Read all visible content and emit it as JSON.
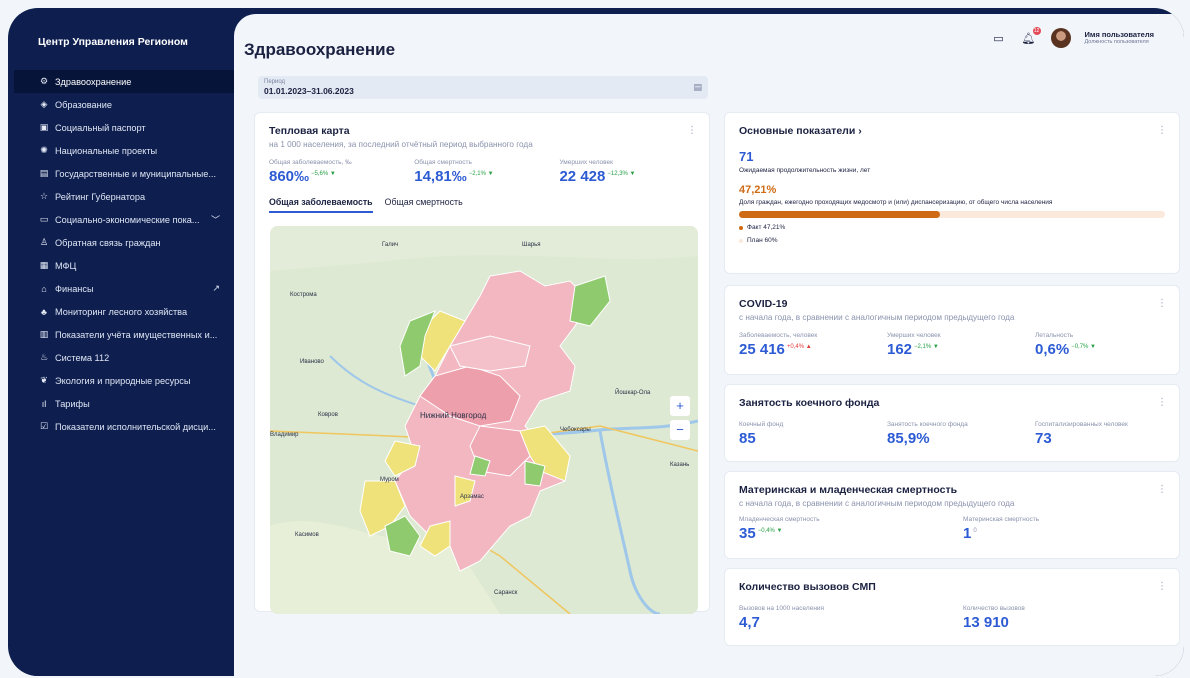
{
  "app": {
    "title": "Центр Управления Регионом"
  },
  "sidebar": {
    "items": [
      {
        "label": "Здравоохранение",
        "icon": "gear-icon",
        "active": true
      },
      {
        "label": "Образование",
        "icon": "graduation-cap-icon"
      },
      {
        "label": "Социальный паспорт",
        "icon": "id-card-icon"
      },
      {
        "label": "Национальные проекты",
        "icon": "emblem-icon"
      },
      {
        "label": "Государственные и муниципальные...",
        "icon": "document-icon"
      },
      {
        "label": "Рейтинг Губернатора",
        "icon": "star-icon"
      },
      {
        "label": "Социально-экономические пока...",
        "icon": "chat-icon",
        "trail": "chevron-down-icon"
      },
      {
        "label": "Обратная связь граждан",
        "icon": "people-icon"
      },
      {
        "label": "МФЦ",
        "icon": "mfc-icon"
      },
      {
        "label": "Финансы",
        "icon": "bank-icon",
        "trail": "external-link-icon"
      },
      {
        "label": "Мониторинг лесного хозяйства",
        "icon": "tree-icon"
      },
      {
        "label": "Показатели учёта имущественных и...",
        "icon": "building-icon"
      },
      {
        "label": "Система 112",
        "icon": "alarm-icon"
      },
      {
        "label": "Экология и природные ресурсы",
        "icon": "leaf-icon"
      },
      {
        "label": "Тарифы",
        "icon": "bars-icon"
      },
      {
        "label": "Показатели исполнительской дисци...",
        "icon": "check-doc-icon"
      }
    ]
  },
  "header": {
    "title": "Здравоохранение",
    "notifications_count": "12",
    "user_name": "Имя пользователя",
    "user_role": "Должность пользователя"
  },
  "period": {
    "label": "Период",
    "value": "01.01.2023–31.06.2023"
  },
  "heatmap": {
    "title": "Тепловая карта",
    "subtitle": "на 1 000 населения, за последний отчётный период выбранного года",
    "metrics": [
      {
        "label": "Общая заболеваемость, ‰",
        "value": "860‰",
        "delta": "−5,6% ▼",
        "trend": "down"
      },
      {
        "label": "Общая смертность",
        "value": "14,81‰",
        "delta": "−2,1% ▼",
        "trend": "down"
      },
      {
        "label": "Умерших человек",
        "value": "22 428",
        "delta": "−12,3% ▼",
        "trend": "down"
      }
    ],
    "tabs": [
      "Общая заболеваемость",
      "Общая смертность"
    ],
    "zoom_in": "+",
    "zoom_out": "−",
    "map_labels": {
      "nizhny": "Нижний Новгород",
      "kostroma": "Кострома",
      "ivanovo": "Иваново",
      "vladimir": "Владимир",
      "cheboksary": "Чебоксары",
      "arzamas": "Арзамас",
      "saransk": "Саранск",
      "kazan": "Казань",
      "murom": "Муром",
      "sharya": "Шарья",
      "galich": "Галич",
      "kovrov": "Ковров",
      "yoshkar": "Йошкар-Ола",
      "kasimov": "Касимов"
    },
    "colors": {
      "high": "#f2b7c1",
      "mid": "#f0e27a",
      "low": "#8fcb6e"
    }
  },
  "key_indicators": {
    "title": "Основные показатели ›",
    "life_value": "71",
    "life_label": "Ожидаемая продолжительность жизни, лет",
    "med_value": "47,21%",
    "med_label": "Доля граждан, ежегодно проходящих медосмотр и (или) диспансеризацию, от общего числа населения",
    "progress": 47.21,
    "fact": "Факт 47,21%",
    "plan": "План 60%"
  },
  "covid": {
    "title": "COVID-19",
    "subtitle": "с начала года, в сравнении с аналогичным периодом предыдущего года",
    "metrics": [
      {
        "label": "Заболеваемость, человек",
        "value": "25 416",
        "delta": "+0,4% ▲",
        "trend": "up"
      },
      {
        "label": "Умерших человек",
        "value": "162",
        "delta": "−2,1% ▼",
        "trend": "down"
      },
      {
        "label": "Летальность",
        "value": "0,6%",
        "delta": "−0,7% ▼",
        "trend": "down"
      }
    ]
  },
  "beds": {
    "title": "Занятость коечного фонда",
    "metrics": [
      {
        "label": "Коечный фонд",
        "value": "85"
      },
      {
        "label": "Занятость коечного фонда",
        "value": "85,9%"
      },
      {
        "label": "Госпитализированных человек",
        "value": "73"
      }
    ]
  },
  "maternal": {
    "title": "Материнская и младенческая смертность",
    "subtitle": "с начала года, в сравнении с аналогичным периодом предыдущего года",
    "metrics": [
      {
        "label": "Младенческая смертность",
        "value": "35",
        "delta": "−0,4% ▼",
        "trend": "down"
      },
      {
        "label": "Материнская смертность",
        "value": "1",
        "delta": "0",
        "trend": "neu"
      }
    ]
  },
  "ambulance": {
    "title": "Количество вызовов СМП",
    "metrics": [
      {
        "label": "Вызовов на 1000 населения",
        "value": "4,7"
      },
      {
        "label": "Количество вызовов",
        "value": "13 910"
      }
    ]
  }
}
